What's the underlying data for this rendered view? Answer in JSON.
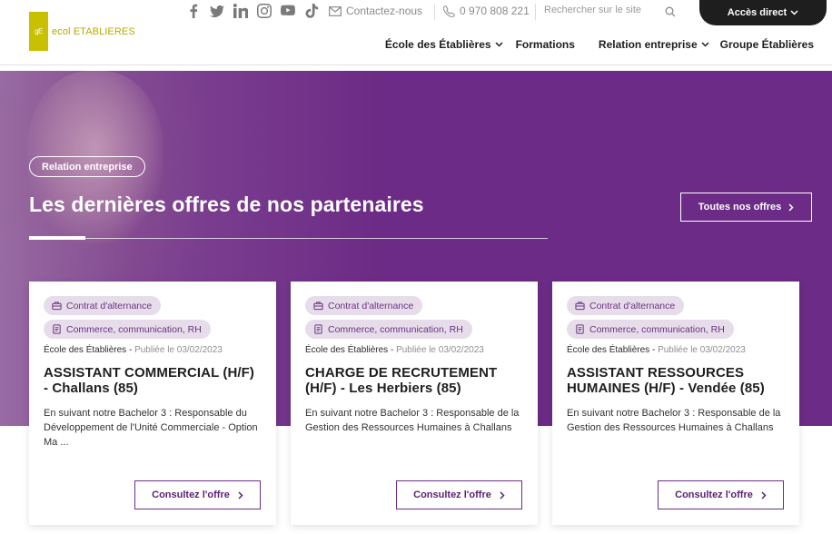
{
  "header": {
    "logo_box": "gE",
    "logo_prefix": "ecol",
    "logo_suffix": "ETABLIERES",
    "socials": [
      "facebook-icon",
      "twitter-icon",
      "linkedin-icon",
      "instagram-icon",
      "youtube-icon",
      "tiktok-icon"
    ],
    "contact_label": "Contactez-nous",
    "phone": "0 970 808 221",
    "search_placeholder": "Rechercher sur le site",
    "acces_label": "Accès direct",
    "nav": [
      {
        "label": "École des Établières",
        "has_dropdown": true
      },
      {
        "label": "Formations",
        "has_dropdown": false
      },
      {
        "label": "Relation entreprise",
        "has_dropdown": true
      },
      {
        "label": "Groupe Établières",
        "has_dropdown": false
      }
    ]
  },
  "hero": {
    "tag": "Relation entreprise",
    "title": "Les dernières offres de nos partenaires",
    "all_offers_label": "Toutes nos offres",
    "background_color": "#6c2b86"
  },
  "offers": [
    {
      "contract": "Contrat d'alternance",
      "category": "Commerce, communication, RH",
      "school": "École des Établières",
      "date": "Publiée le 03/02/2023",
      "title": "ASSISTANT COMMERCIAL (H/F) - Challans (85)",
      "description": "En suivant notre Bachelor 3 : Responsable du Développement de l'Unité Commerciale - Option Ma ...",
      "cta": "Consultez l'offre"
    },
    {
      "contract": "Contrat d'alternance",
      "category": "Commerce, communication, RH",
      "school": "École des Établières",
      "date": "Publiée le 03/02/2023",
      "title": "CHARGE DE RECRUTEMENT (H/F) - Les Herbiers (85)",
      "description": "En suivant notre Bachelor 3 : Responsable de la Gestion des Ressources Humaines à Challans",
      "cta": "Consultez l'offre"
    },
    {
      "contract": "Contrat d'alternance",
      "category": "Commerce, communication, RH",
      "school": "École des Établières",
      "date": "Publiée le 03/02/2023",
      "title": "ASSISTANT RESSOURCES HUMAINES (H/F) - Vendée (85)",
      "description": "En suivant notre Bachelor 3 : Responsable de la Gestion des Ressources Humaines à Challans",
      "cta": "Consultez l'offre"
    }
  ],
  "colors": {
    "brand_purple": "#6c2b86",
    "logo_yellow": "#c8c000",
    "badge_bg": "#e6dcea"
  }
}
